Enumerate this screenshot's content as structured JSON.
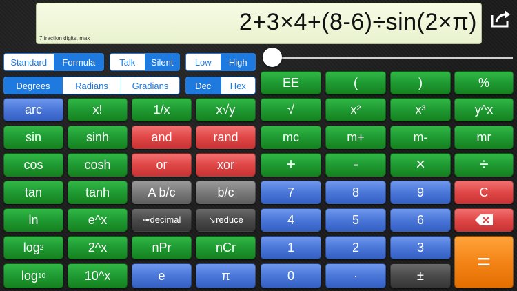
{
  "display": {
    "expression": "2+3×4+(8-6)÷sin(2×π)",
    "hint": "7 fraction digits, max"
  },
  "share_icon": "share-icon",
  "toggles": {
    "mode": {
      "options": [
        "Standard",
        "Formula"
      ],
      "selected": "Formula"
    },
    "speech": {
      "options": [
        "Talk",
        "Silent"
      ],
      "selected": "Silent"
    },
    "precision": {
      "options": [
        "Low",
        "High"
      ],
      "selected": "High"
    },
    "angle": {
      "options": [
        "Degrees",
        "Radians",
        "Gradians"
      ],
      "selected": "Degrees"
    },
    "base": {
      "options": [
        "Dec",
        "Hex"
      ],
      "selected": "Dec"
    }
  },
  "slider": {
    "value": 0
  },
  "keys": {
    "arc": "arc",
    "fact": "x!",
    "inv": "1/x",
    "root": "x√y",
    "sin": "sin",
    "sinh": "sinh",
    "and": "and",
    "rand": "rand",
    "cos": "cos",
    "cosh": "cosh",
    "or": "or",
    "xor": "xor",
    "tan": "tan",
    "tanh": "tanh",
    "abc": "A b/c",
    "bc": "b/c",
    "ln": "ln",
    "ex": "e^x",
    "decimal": "➠decimal",
    "reduce": "↘reduce",
    "log2": "log",
    "log2_sub": "2",
    "twox": "2^x",
    "npr": "nPr",
    "ncr": "nCr",
    "log10": "log",
    "log10_sub": "10",
    "tenx": "10^x",
    "e": "e",
    "pi": "π",
    "ee": "EE",
    "lparen": "(",
    "rparen": ")",
    "percent": "%",
    "sqrt": "√",
    "sq": "x²",
    "cube": "x³",
    "ypow": "y^x",
    "mc": "mc",
    "mplus": "m+",
    "mminus": "m-",
    "mr": "mr",
    "plus": "+",
    "minus": "-",
    "times": "×",
    "divide": "÷",
    "n7": "7",
    "n8": "8",
    "n9": "9",
    "clear": "C",
    "n4": "4",
    "n5": "5",
    "n6": "6",
    "n1": "1",
    "n2": "2",
    "n3": "3",
    "equals": "=",
    "n0": "0",
    "dot": "·",
    "sign": "±"
  },
  "colors": {
    "accent": "#1f7ae0",
    "green": "#1f9a33",
    "red": "#e04747",
    "blue": "#4a77d8",
    "orange": "#f48417"
  }
}
